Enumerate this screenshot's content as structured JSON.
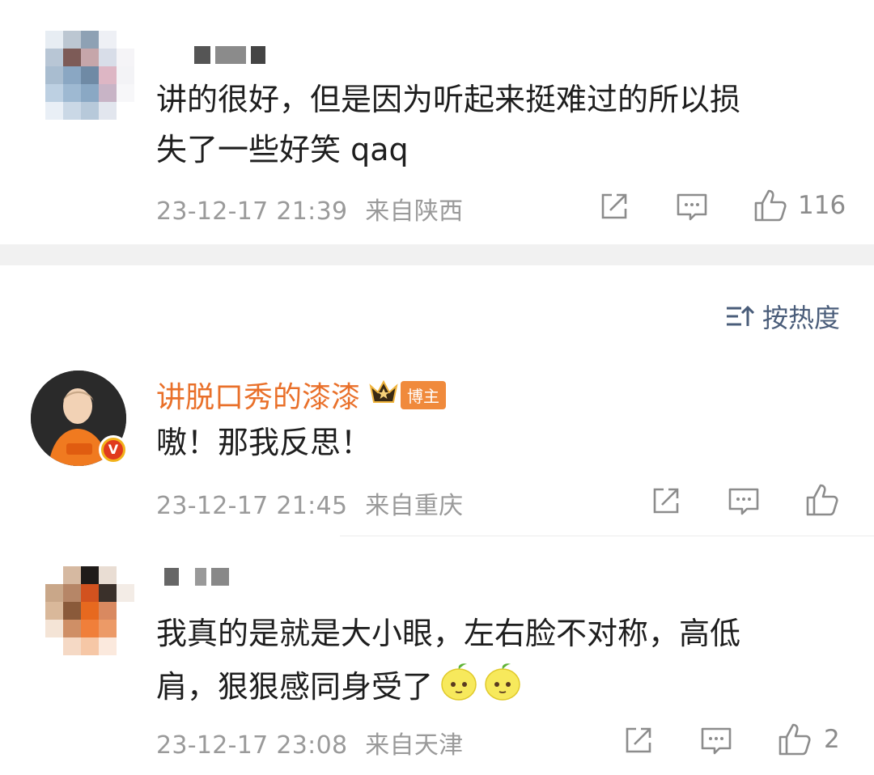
{
  "comments_top": {
    "text_line1": "讲的很好，但是因为听起来挺难过的所以损",
    "text_line2": "失了一些好笑 qaq",
    "time": "23-12-17 21:39",
    "location": "来自陕西",
    "likes": "116"
  },
  "sort": {
    "label": "按热度",
    "icon": "sort-icon"
  },
  "reply_author": {
    "name": "讲脱口秀的漆漆",
    "badge": "博主",
    "text": "嗷！那我反思！",
    "time": "23-12-17 21:45",
    "location": "来自重庆",
    "likes": ""
  },
  "comment_bottom": {
    "text_line1": "我真的是就是大小眼，左右脸不对称，高低",
    "text_line2": "肩，狠狠感同身受了",
    "time": "23-12-17 23:08",
    "location": "来自天津",
    "likes": "2"
  },
  "colors": {
    "author_name": "#e9702a",
    "badge_bg": "#f08a3c",
    "sort_text": "#4a5d7a",
    "meta_text": "#9a9a9a",
    "divider": "#f1f1f1"
  }
}
